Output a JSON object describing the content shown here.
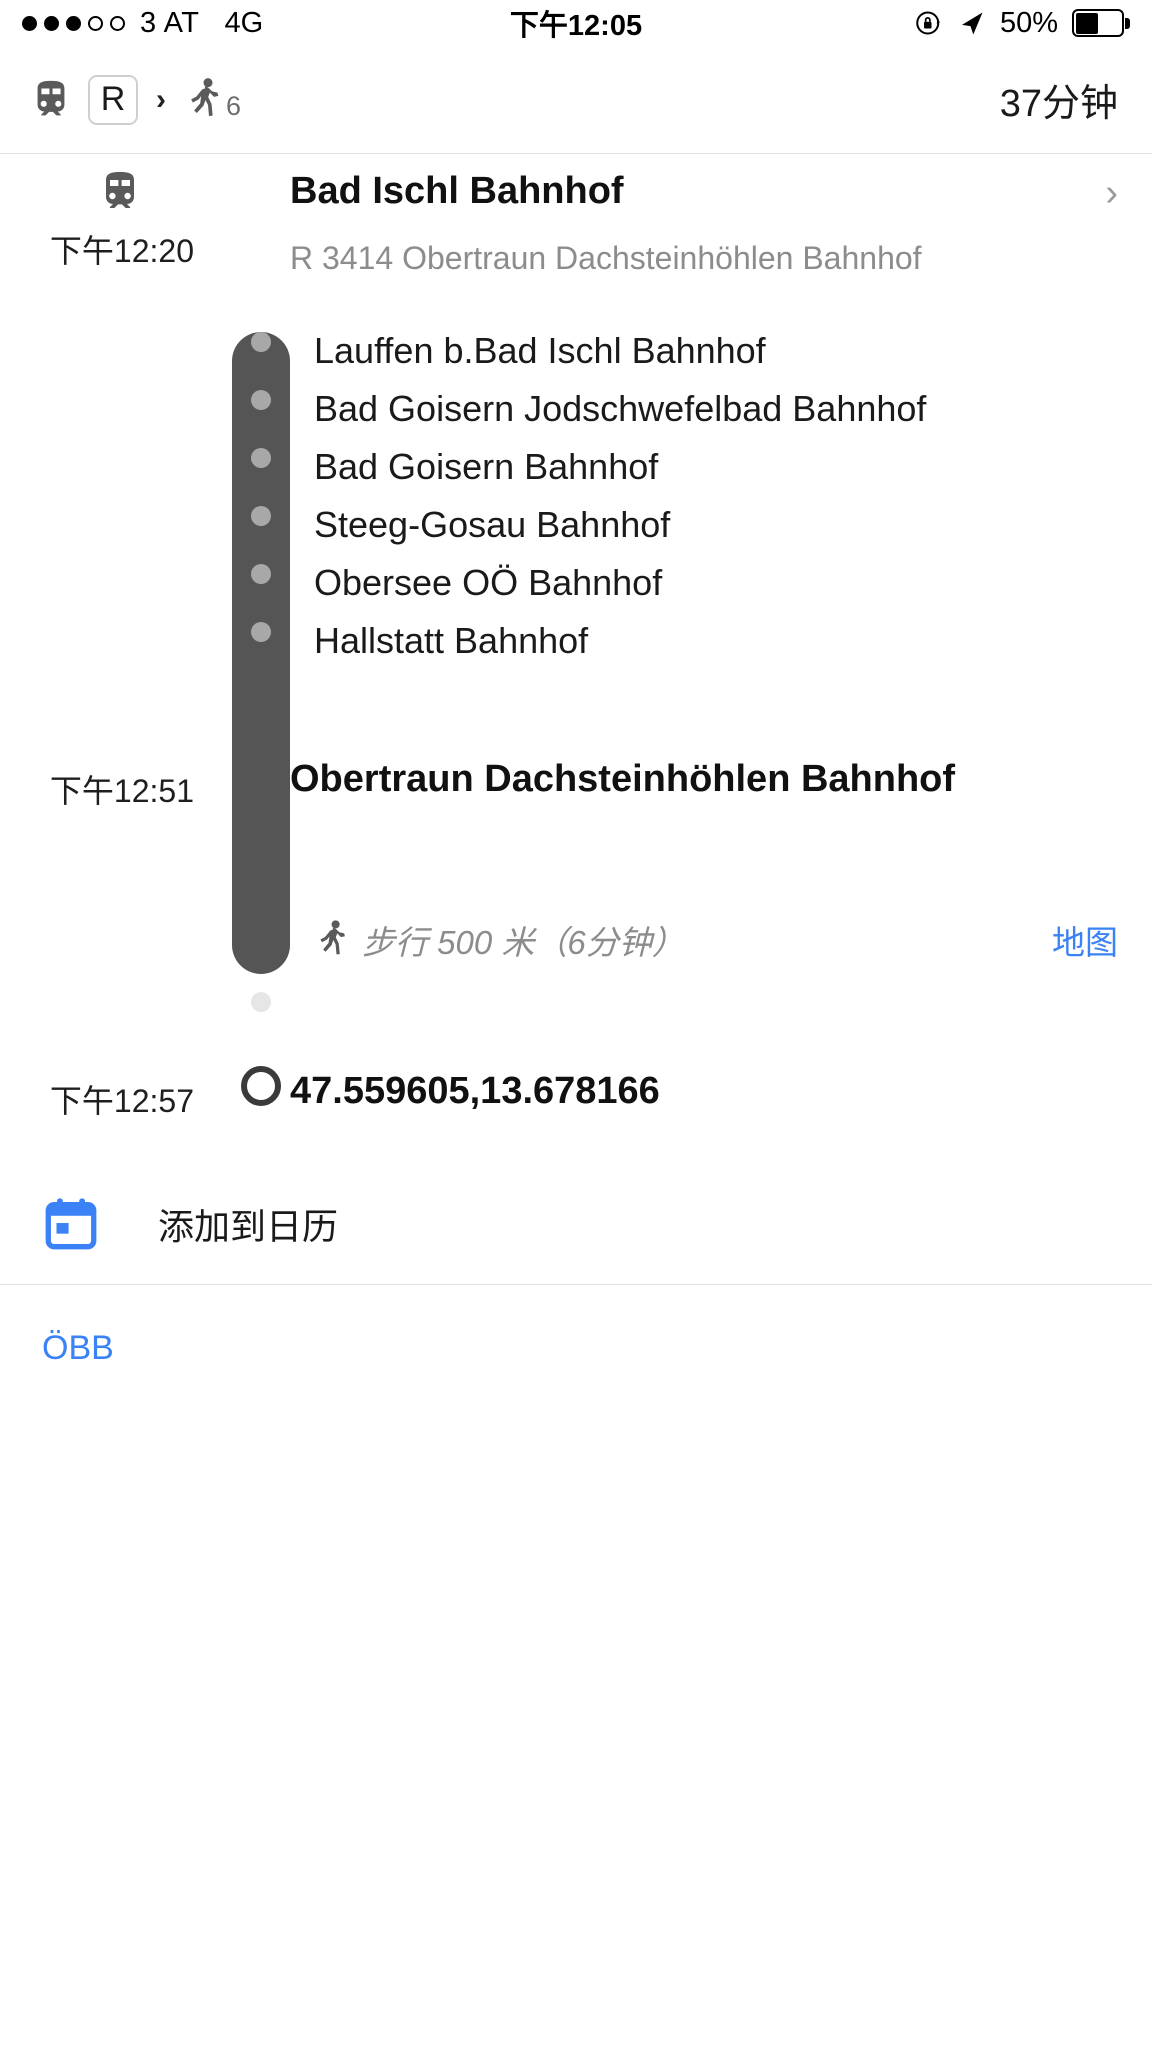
{
  "status_bar": {
    "signal_filled": 3,
    "signal_empty": 2,
    "carrier": "3 AT",
    "network": "4G",
    "time": "下午12:05",
    "rotation_lock_icon": "rotation-lock-icon",
    "location_icon": "location-arrow-icon",
    "battery_percent": "50%",
    "battery_level": 50
  },
  "summary": {
    "train_icon": "train-icon",
    "line_badge": "R",
    "separator": "›",
    "walk_icon": "walking-icon",
    "walk_minutes": "6",
    "total_duration": "37分钟"
  },
  "itinerary": {
    "departure": {
      "time": "下午12:20",
      "station": "Bad Ischl Bahnhof",
      "route": "R 3414 Obertraun Dachsteinhöhlen Bahnhof",
      "mode_icon": "train-icon",
      "disclosure_icon": "chevron-right-icon"
    },
    "intermediate_stops": [
      "Lauffen b.Bad Ischl Bahnhof",
      "Bad Goisern Jodschwefelbad Bahnhof",
      "Bad Goisern Bahnhof",
      "Steeg-Gosau Bahnhof",
      "Obersee OÖ Bahnhof",
      "Hallstatt Bahnhof"
    ],
    "arrival": {
      "time": "下午12:51",
      "station": "Obertraun Dachsteinhöhlen Bahnhof"
    },
    "walking_segment": {
      "icon": "walking-icon",
      "text": "步行 500 米（6分钟）",
      "distance": "500 米",
      "duration": "6分钟",
      "map_link": "地图"
    },
    "destination": {
      "time": "下午12:57",
      "label": "47.559605,13.678166"
    }
  },
  "calendar": {
    "icon": "calendar-icon",
    "label": "添加到日历"
  },
  "footer": {
    "attribution": "ÖBB"
  },
  "colors": {
    "track": "#555555",
    "accent_link": "#3b82f6",
    "muted_text": "#8c8c8c"
  }
}
